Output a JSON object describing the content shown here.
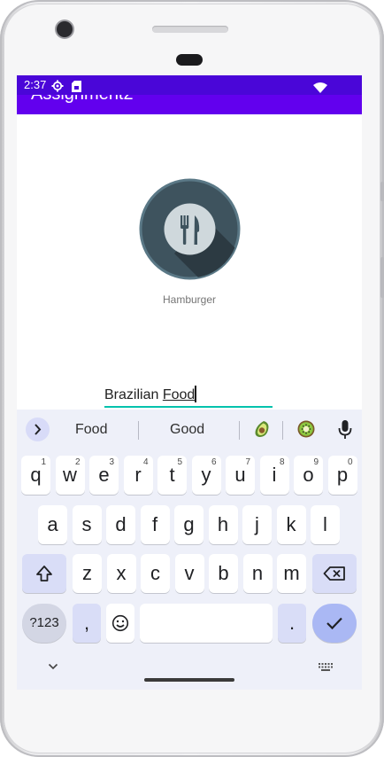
{
  "status_bar": {
    "time": "2:37",
    "icons": [
      "settings-gear-icon",
      "sim-card-icon",
      "wifi-icon"
    ]
  },
  "app_bar": {
    "title": "Assignment2",
    "color": "#6200ee"
  },
  "main": {
    "image_icon": "fork-knife-icon",
    "food_label": "Hamburger",
    "input": {
      "prefix": "Brazilian ",
      "composing": "Food"
    }
  },
  "keyboard": {
    "suggestions": [
      "Food",
      "Good"
    ],
    "emoji_suggestions": [
      "avocado-emoji",
      "kiwi-emoji"
    ],
    "row1": [
      {
        "key": "q",
        "hint": "1"
      },
      {
        "key": "w",
        "hint": "2"
      },
      {
        "key": "e",
        "hint": "3"
      },
      {
        "key": "r",
        "hint": "4"
      },
      {
        "key": "t",
        "hint": "5"
      },
      {
        "key": "y",
        "hint": "6"
      },
      {
        "key": "u",
        "hint": "7"
      },
      {
        "key": "i",
        "hint": "8"
      },
      {
        "key": "o",
        "hint": "9"
      },
      {
        "key": "p",
        "hint": "0"
      }
    ],
    "row2": [
      "a",
      "s",
      "d",
      "f",
      "g",
      "h",
      "j",
      "k",
      "l"
    ],
    "row3": [
      "z",
      "x",
      "c",
      "v",
      "b",
      "n",
      "m"
    ],
    "symbols_label": "?123",
    "comma_label": ",",
    "period_label": "."
  },
  "colors": {
    "status_bar": "#4a06d8",
    "accent_underline": "#03c2ad",
    "enter_key": "#aab8f4"
  }
}
